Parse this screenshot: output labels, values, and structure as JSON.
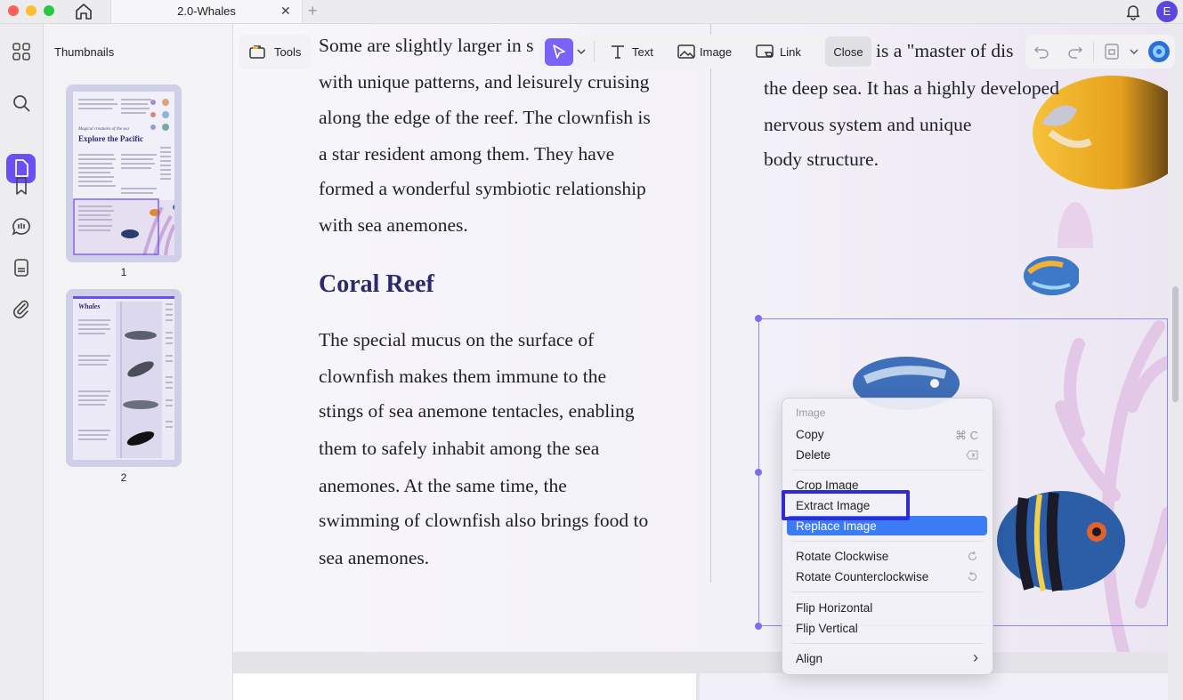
{
  "tab": {
    "title": "2.0-Whales",
    "close": "✕",
    "add": "+"
  },
  "user": {
    "avatar_letter": "E"
  },
  "sidebar": {
    "title": "Thumbnails",
    "pages": [
      "1",
      "2"
    ]
  },
  "thumbnails": {
    "page1_script": "Magical creatures of the sea",
    "page1_title": "Explore the Pacific",
    "page2_title": "Whales"
  },
  "toolbar": {
    "tools": "Tools",
    "text": "Text",
    "image": "Image",
    "link": "Link",
    "close": "Close"
  },
  "document": {
    "left_column": {
      "top_lines": [
        "Some are slightly larger in s",
        "with unique patterns, and leisurely cruising",
        "along the edge of the reef. The clownfish is",
        "a star resident among them. They have",
        "formed a wonderful symbiotic relationship",
        "with sea anemones."
      ],
      "heading": "Coral Reef",
      "body_lines": [
        " The special mucus on the surface of",
        "clownfish makes them immune to the",
        "stings of sea anemone tentacles, enabling",
        "them to safely inhabit among the sea",
        "anemones. At the same time, the",
        "swimming of clownfish also brings food to",
        "sea anemones."
      ]
    },
    "right_column": {
      "lines": [
        "is a \"master of dis",
        "the deep sea. It has a highly developed",
        "nervous system and unique",
        "body structure."
      ]
    }
  },
  "context_menu": {
    "header": "Image",
    "copy": "Copy",
    "copy_shortcut": "⌘ C",
    "delete": "Delete",
    "crop": "Crop Image",
    "extract": "Extract Image",
    "replace": "Replace Image",
    "rotate_cw": "Rotate Clockwise",
    "rotate_ccw": "Rotate Counterclockwise",
    "flip_h": "Flip Horizontal",
    "flip_v": "Flip Vertical",
    "align": "Align",
    "align_arrow": "›"
  },
  "colors": {
    "accent": "#6a4ff5",
    "highlight": "#3b7bf4",
    "annotation_box": "#2f2bd6",
    "heading": "#2b2a6b"
  },
  "icons": [
    "home-icon",
    "bell-icon",
    "grid-icon",
    "search-icon",
    "pages-icon",
    "bookmark-icon",
    "comment-icon",
    "stamp-icon",
    "attachment-icon",
    "toolbox-icon",
    "cursor-icon",
    "text-icon",
    "image-icon",
    "link-icon",
    "undo-icon",
    "redo-icon",
    "save-icon",
    "ai-assistant-icon"
  ]
}
